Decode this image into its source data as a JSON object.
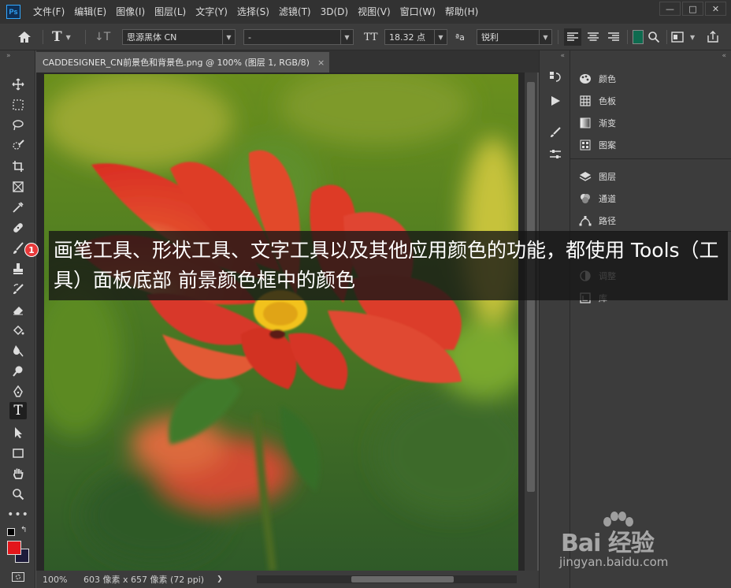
{
  "app": {
    "logo": "Ps"
  },
  "menu": [
    "文件(F)",
    "编辑(E)",
    "图像(I)",
    "图层(L)",
    "文字(Y)",
    "选择(S)",
    "滤镜(T)",
    "3D(D)",
    "视图(V)",
    "窗口(W)",
    "帮助(H)"
  ],
  "window_controls": {
    "minimize": "—",
    "maximize": "□",
    "close": "✕"
  },
  "options": {
    "font_family": "思源黑体 CN",
    "font_style": "-",
    "font_size": "18.32 点",
    "aa_label": "ªa",
    "antialias": "锐利",
    "text_color": "#0e6b4f"
  },
  "document": {
    "tab_title": "CADDESIGNER_CN前景色和背景色.png @ 100% (图层 1, RGB/8)",
    "close": "×"
  },
  "status": {
    "zoom": "100%",
    "doc_info": "603 像素 x 657 像素 (72 ppi)",
    "arrow": "❯"
  },
  "colors": {
    "foreground": "#e3161b",
    "background": "#1d1b3a"
  },
  "panels": {
    "group1": [
      "颜色",
      "色板",
      "渐变",
      "图案"
    ],
    "group2": [
      "图层",
      "通道",
      "路径"
    ],
    "group3": [
      "调整",
      "库"
    ]
  },
  "caption": {
    "badge": "1",
    "text": "画笔工具、形状工具、文字工具以及其他应用颜色的功能，都使用 Tools（工具）面板底部 前景颜色框中的颜色"
  },
  "watermark": {
    "brand": "Bai 经验",
    "url": "jingyan.baidu.com"
  }
}
